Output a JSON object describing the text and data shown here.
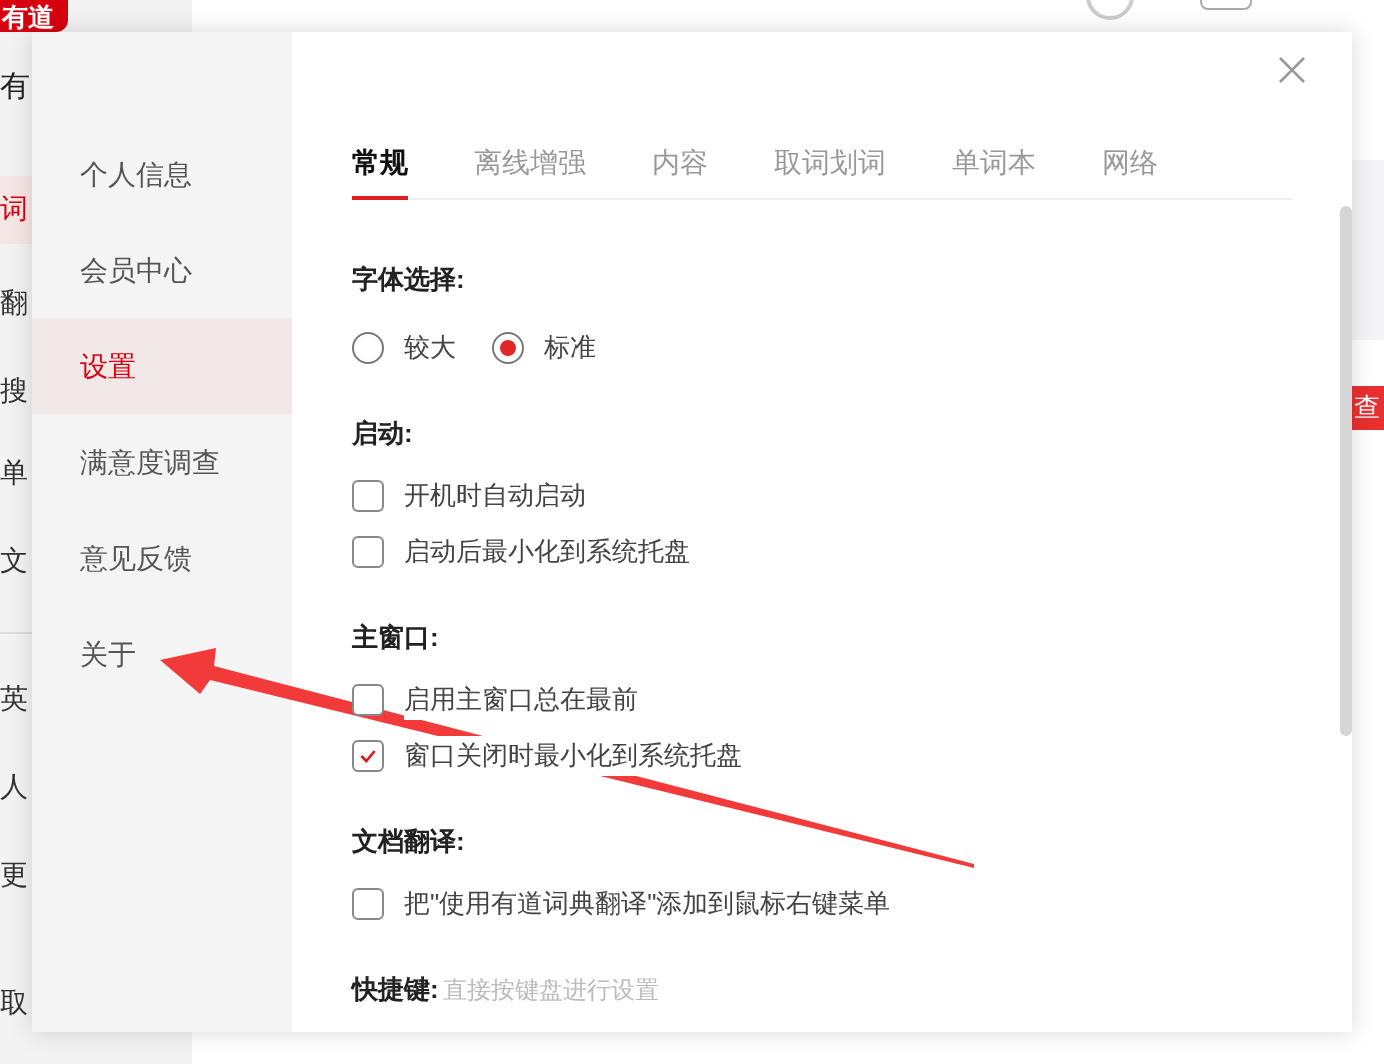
{
  "background_app": {
    "logo": "有道",
    "title": "有",
    "nav": [
      {
        "label": "词",
        "selected": true
      },
      {
        "label": "翻",
        "selected": false
      },
      {
        "label": "搜",
        "selected": false
      },
      {
        "label": "单",
        "selected": false
      },
      {
        "label": "文",
        "selected": false
      },
      {
        "label": "英",
        "selected": false
      },
      {
        "label": "人",
        "selected": false
      },
      {
        "label": "更",
        "selected": false
      },
      {
        "label": "取",
        "selected": false
      }
    ],
    "search_button": "查"
  },
  "dialog": {
    "sidebar": [
      {
        "label": "个人信息",
        "selected": false
      },
      {
        "label": "会员中心",
        "selected": false
      },
      {
        "label": "设置",
        "selected": true
      },
      {
        "label": "满意度调查",
        "selected": false
      },
      {
        "label": "意见反馈",
        "selected": false
      },
      {
        "label": "关于",
        "selected": false
      }
    ],
    "tabs": [
      {
        "label": "常规",
        "selected": true
      },
      {
        "label": "离线增强",
        "selected": false
      },
      {
        "label": "内容",
        "selected": false
      },
      {
        "label": "取词划词",
        "selected": false
      },
      {
        "label": "单词本",
        "selected": false
      },
      {
        "label": "网络",
        "selected": false
      }
    ],
    "sections": [
      {
        "title": "字体选择:",
        "options": [
          {
            "kind": "radio",
            "label": "较大",
            "selected": false
          },
          {
            "kind": "radio",
            "label": "标准",
            "selected": true
          }
        ]
      },
      {
        "title": "启动:",
        "options": [
          {
            "kind": "checkbox",
            "label": "开机时自动启动",
            "checked": false
          },
          {
            "kind": "checkbox",
            "label": "启动后最小化到系统托盘",
            "checked": false
          }
        ]
      },
      {
        "title": "主窗口:",
        "options": [
          {
            "kind": "checkbox",
            "label": "启用主窗口总在最前",
            "checked": false
          },
          {
            "kind": "checkbox",
            "label": "窗口关闭时最小化到系统托盘",
            "checked": true
          }
        ]
      },
      {
        "title": "文档翻译:",
        "options": [
          {
            "kind": "checkbox",
            "label": "把\"使用有道词典翻译\"添加到鼠标右键菜单",
            "checked": false
          }
        ]
      },
      {
        "title": "快捷键:",
        "hint": "直接按键盘进行设置"
      }
    ]
  }
}
